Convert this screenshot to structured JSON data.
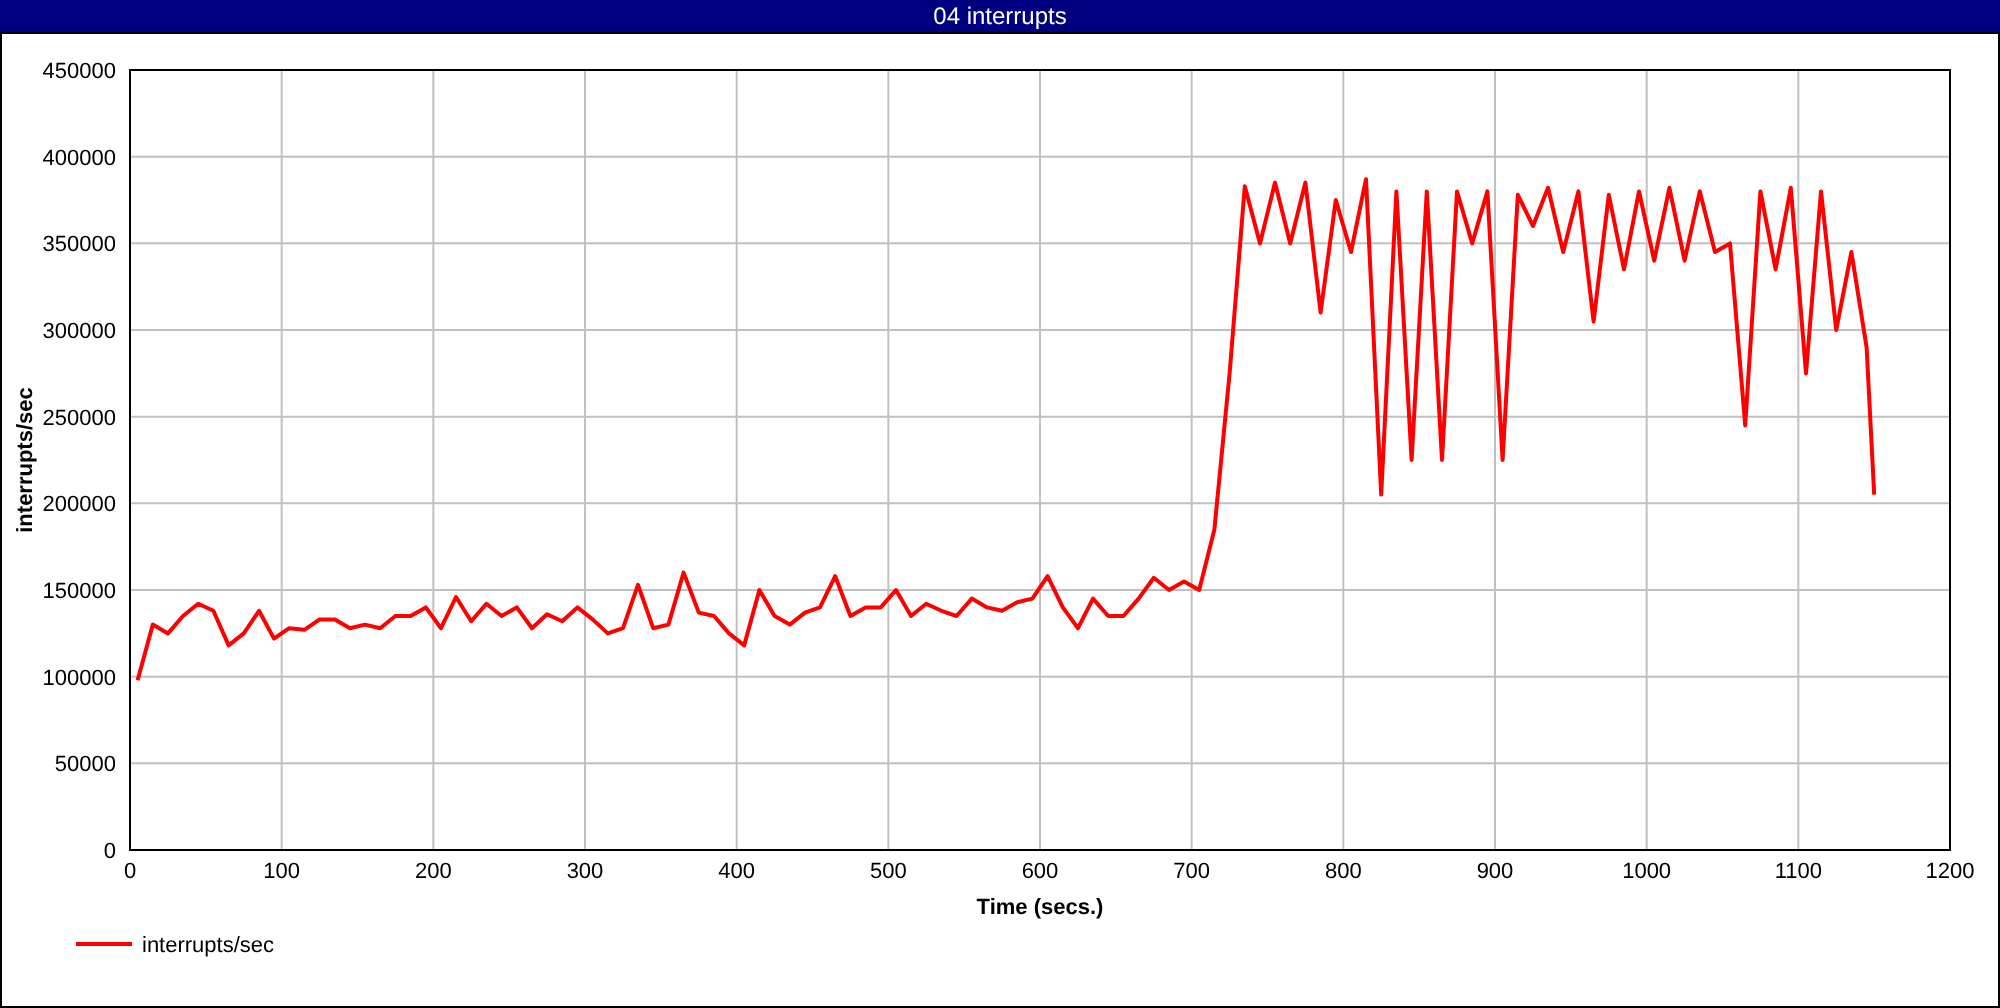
{
  "window": {
    "title": "04 interrupts"
  },
  "chart": {
    "chart_data": {
      "type": "line",
      "xlabel": "Time (secs.)",
      "ylabel": "interrupts/sec",
      "xlim": [
        0,
        1200
      ],
      "ylim": [
        0,
        450000
      ],
      "grid": true,
      "xticks": [
        0,
        100,
        200,
        300,
        400,
        500,
        600,
        700,
        800,
        900,
        1000,
        1100,
        1200
      ],
      "yticks": [
        0,
        50000,
        100000,
        150000,
        200000,
        250000,
        300000,
        350000,
        400000,
        450000
      ],
      "x": [
        5,
        15,
        25,
        35,
        45,
        55,
        65,
        75,
        85,
        95,
        105,
        115,
        125,
        135,
        145,
        155,
        165,
        175,
        185,
        195,
        205,
        215,
        225,
        235,
        245,
        255,
        265,
        275,
        285,
        295,
        305,
        315,
        325,
        335,
        345,
        355,
        365,
        375,
        385,
        395,
        405,
        415,
        425,
        435,
        445,
        455,
        465,
        475,
        485,
        495,
        505,
        515,
        525,
        535,
        545,
        555,
        565,
        575,
        585,
        595,
        605,
        615,
        625,
        635,
        645,
        655,
        665,
        675,
        685,
        695,
        705,
        715,
        725,
        735,
        745,
        755,
        765,
        775,
        785,
        795,
        805,
        815,
        825,
        835,
        845,
        855,
        865,
        875,
        885,
        895,
        905,
        915,
        925,
        935,
        945,
        955,
        965,
        975,
        985,
        995,
        1005,
        1015,
        1025,
        1035,
        1045,
        1055,
        1065,
        1075,
        1085,
        1095,
        1105,
        1115,
        1125,
        1135,
        1145,
        1150
      ],
      "series": [
        {
          "name": "interrupts/sec",
          "color": "#ff0000",
          "values": [
            98000,
            130000,
            125000,
            135000,
            142000,
            138000,
            118000,
            125000,
            138000,
            122000,
            128000,
            127000,
            133000,
            133000,
            128000,
            130000,
            128000,
            135000,
            135000,
            140000,
            128000,
            146000,
            132000,
            142000,
            135000,
            140000,
            128000,
            136000,
            132000,
            140000,
            133000,
            125000,
            128000,
            153000,
            128000,
            130000,
            160000,
            137000,
            135000,
            125000,
            118000,
            150000,
            135000,
            130000,
            137000,
            140000,
            158000,
            135000,
            140000,
            140000,
            150000,
            135000,
            142000,
            138000,
            135000,
            145000,
            140000,
            138000,
            143000,
            145000,
            158000,
            140000,
            128000,
            145000,
            135000,
            135000,
            145000,
            157000,
            150000,
            155000,
            150000,
            185000,
            275000,
            383000,
            350000,
            385000,
            350000,
            385000,
            310000,
            375000,
            345000,
            387000,
            205000,
            380000,
            225000,
            380000,
            225000,
            380000,
            350000,
            380000,
            225000,
            378000,
            360000,
            382000,
            345000,
            380000,
            305000,
            378000,
            335000,
            380000,
            340000,
            382000,
            340000,
            380000,
            345000,
            350000,
            245000,
            380000,
            335000,
            382000,
            275000,
            380000,
            300000,
            345000,
            290000,
            205000
          ]
        }
      ]
    }
  }
}
